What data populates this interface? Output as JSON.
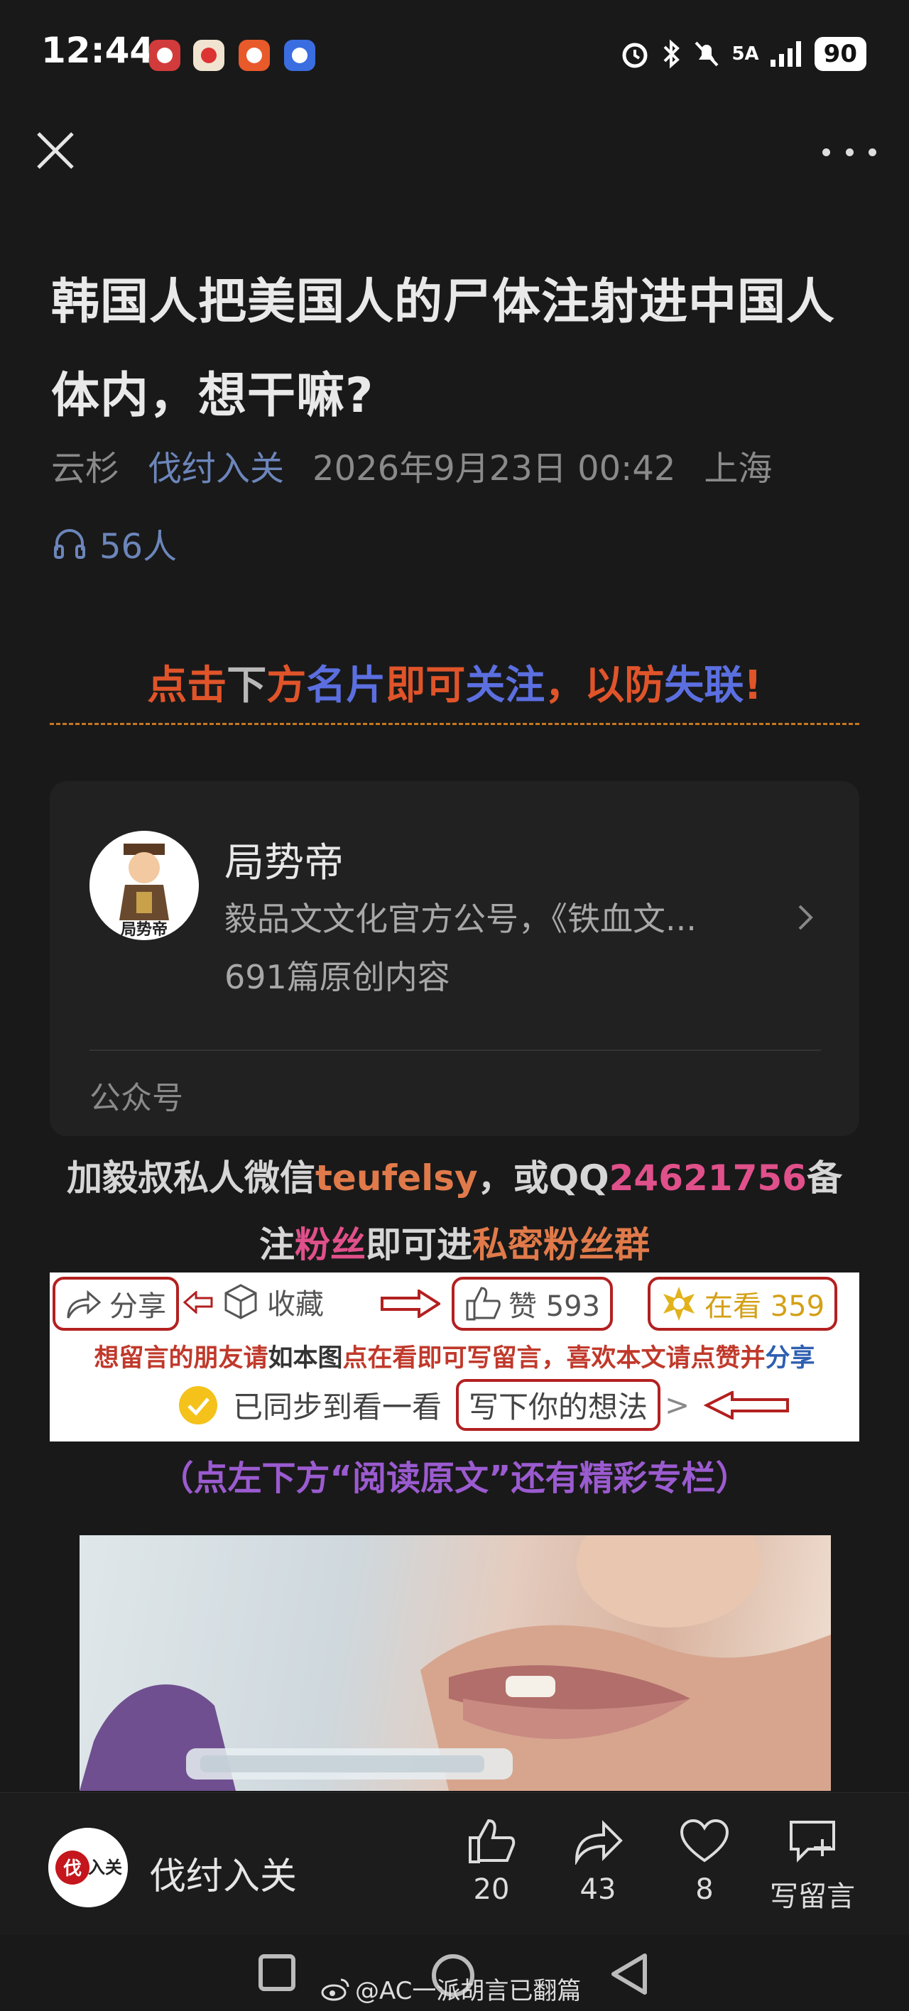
{
  "status_bar": {
    "time": "12:44",
    "network": "5A",
    "battery": "90"
  },
  "article": {
    "title": "韩国人把美国人的尸体注射进中国人体内，想干嘛?",
    "meta": {
      "source": "云杉",
      "author": "伐纣入关",
      "datetime": "2026年9月23日 00:42",
      "location": "上海"
    },
    "listeners": "56人"
  },
  "follow_notice": {
    "segments": [
      {
        "text": "点击",
        "color": "#e0542a"
      },
      {
        "text": "下",
        "color": "#b8b8b8"
      },
      {
        "text": "方",
        "color": "#e0542a"
      },
      {
        "text": "名片",
        "color": "#5b6fe0"
      },
      {
        "text": "即可",
        "color": "#e0542a"
      },
      {
        "text": "关注",
        "color": "#5b6fe0"
      },
      {
        "text": "，以",
        "color": "#e0542a"
      },
      {
        "text": "防",
        "color": "#e0542a"
      },
      {
        "text": "失联",
        "color": "#5b6fe0"
      },
      {
        "text": "!",
        "color": "#e0542a"
      }
    ]
  },
  "profile_card": {
    "name": "局势帝",
    "description": "毅品文文化官方公号，《铁血文...",
    "count": "691篇原创内容",
    "type": "公众号"
  },
  "wechat_note": {
    "line1": [
      {
        "text": "加毅叔私人微信",
        "color": "#d6d6d6"
      },
      {
        "text": "teufelsy",
        "color": "#e07a4a"
      },
      {
        "text": "，或QQ",
        "color": "#d6d6d6"
      },
      {
        "text": "24621756",
        "color": "#e0508a"
      },
      {
        "text": "备",
        "color": "#d6d6d6"
      }
    ],
    "line2": [
      {
        "text": "注",
        "color": "#d6d6d6"
      },
      {
        "text": "粉丝",
        "color": "#e0508a"
      },
      {
        "text": "即可进",
        "color": "#d6d6d6"
      },
      {
        "text": "私密粉丝群",
        "color": "#e07a4a"
      }
    ]
  },
  "guide_image": {
    "share": "分享",
    "collect": "收藏",
    "like": "赞 593",
    "watching": "在看 359",
    "instruction": [
      {
        "text": "想留言的朋友请",
        "color": "#c0392b"
      },
      {
        "text": "如本图",
        "color": "#333"
      },
      {
        "text": "点在看即可写留言，",
        "color": "#c0392b"
      },
      {
        "text": "喜欢本文请",
        "color": "#c0392b"
      },
      {
        "text": "点赞并",
        "color": "#c0392b"
      },
      {
        "text": "分享",
        "color": "#2e5fb0"
      }
    ],
    "synced": "已同步到看一看",
    "write": "写下你的想法"
  },
  "read_original": "（点左下方“阅读原文”还有精彩专栏）",
  "bottom_bar": {
    "account_name": "伐纣入关",
    "like_count": "20",
    "share_count": "43",
    "fav_count": "8",
    "comment_label": "写留言"
  },
  "watermark": "@AC一派胡言已翻篇"
}
